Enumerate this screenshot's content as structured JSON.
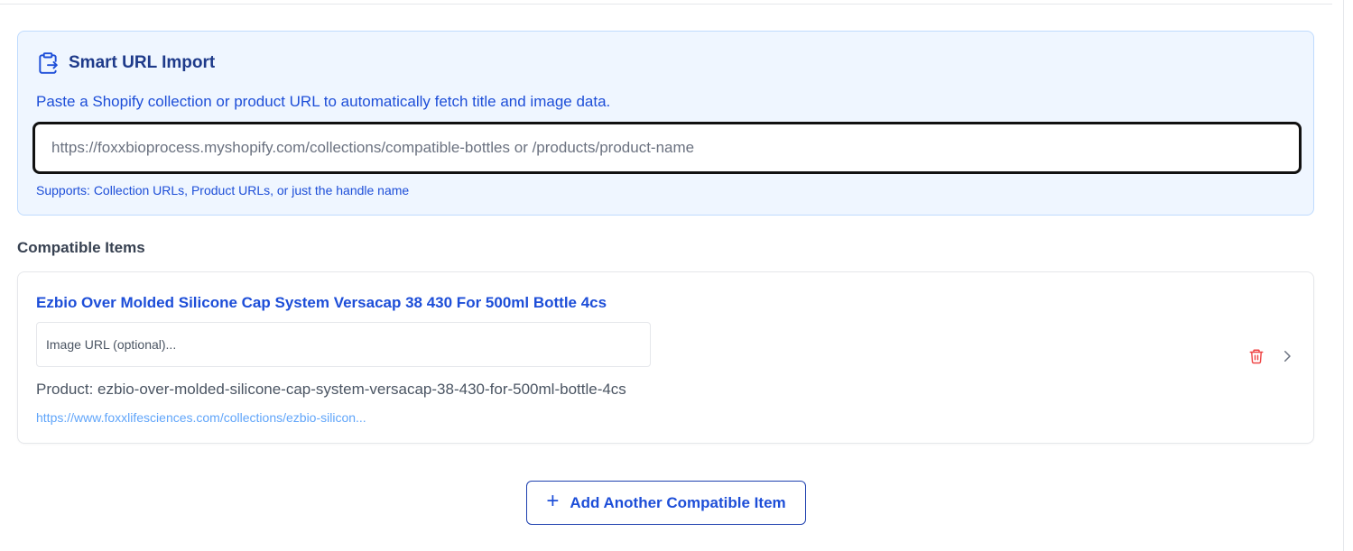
{
  "smart_import": {
    "title": "Smart URL Import",
    "icon": "clipboard-import-icon",
    "description": "Paste a Shopify collection or product URL to automatically fetch title and image data.",
    "url_input": {
      "value": "",
      "placeholder": "https://foxxbioprocess.myshopify.com/collections/compatible-bottles or /products/product-name"
    },
    "hint": "Supports: Collection URLs, Product URLs, or just the handle name"
  },
  "compatible_items": {
    "section_title": "Compatible Items",
    "items": [
      {
        "title": "Ezbio Over Molded Silicone Cap System Versacap 38 430 For 500ml Bottle 4cs",
        "image_url_input": {
          "value": "",
          "placeholder": "Image URL (optional)..."
        },
        "product_line": "Product: ezbio-over-molded-silicone-cap-system-versacap-38-430-for-500ml-bottle-4cs",
        "link_text": "https://www.foxxlifesciences.com/collections/ezbio-silicon...",
        "delete_icon": "trash-icon",
        "expand_icon": "chevron-right-icon"
      }
    ]
  },
  "add_button": {
    "icon": "+",
    "label": "Add Another Compatible Item"
  },
  "colors": {
    "accent": "#1d4ed8",
    "panel_bg": "#eff6ff",
    "panel_border": "#bfdbfe",
    "danger": "#ef4444",
    "link": "#60a5fa"
  }
}
